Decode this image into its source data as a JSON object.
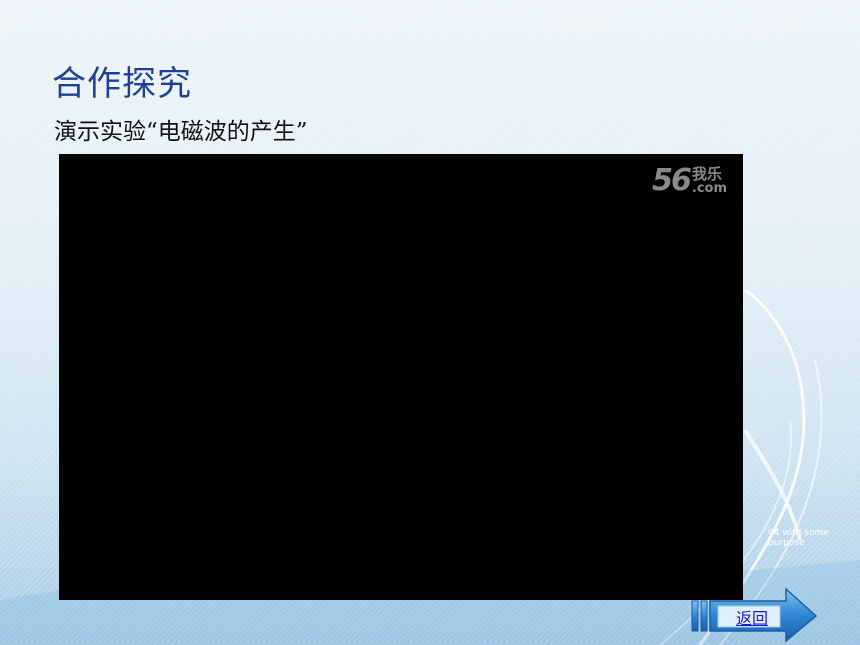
{
  "slide": {
    "title": "合作探究",
    "subtitle": "演示实验“电磁波的产生”"
  },
  "video": {
    "watermark_number": "56",
    "watermark_cn": "我乐",
    "watermark_com": ".com"
  },
  "background": {
    "caption": "04 with some purpose"
  },
  "nav": {
    "return_label": "返回"
  },
  "colors": {
    "title": "#1f3f9b",
    "accent_blue": "#2b7fd0",
    "link": "#1a1aee"
  }
}
